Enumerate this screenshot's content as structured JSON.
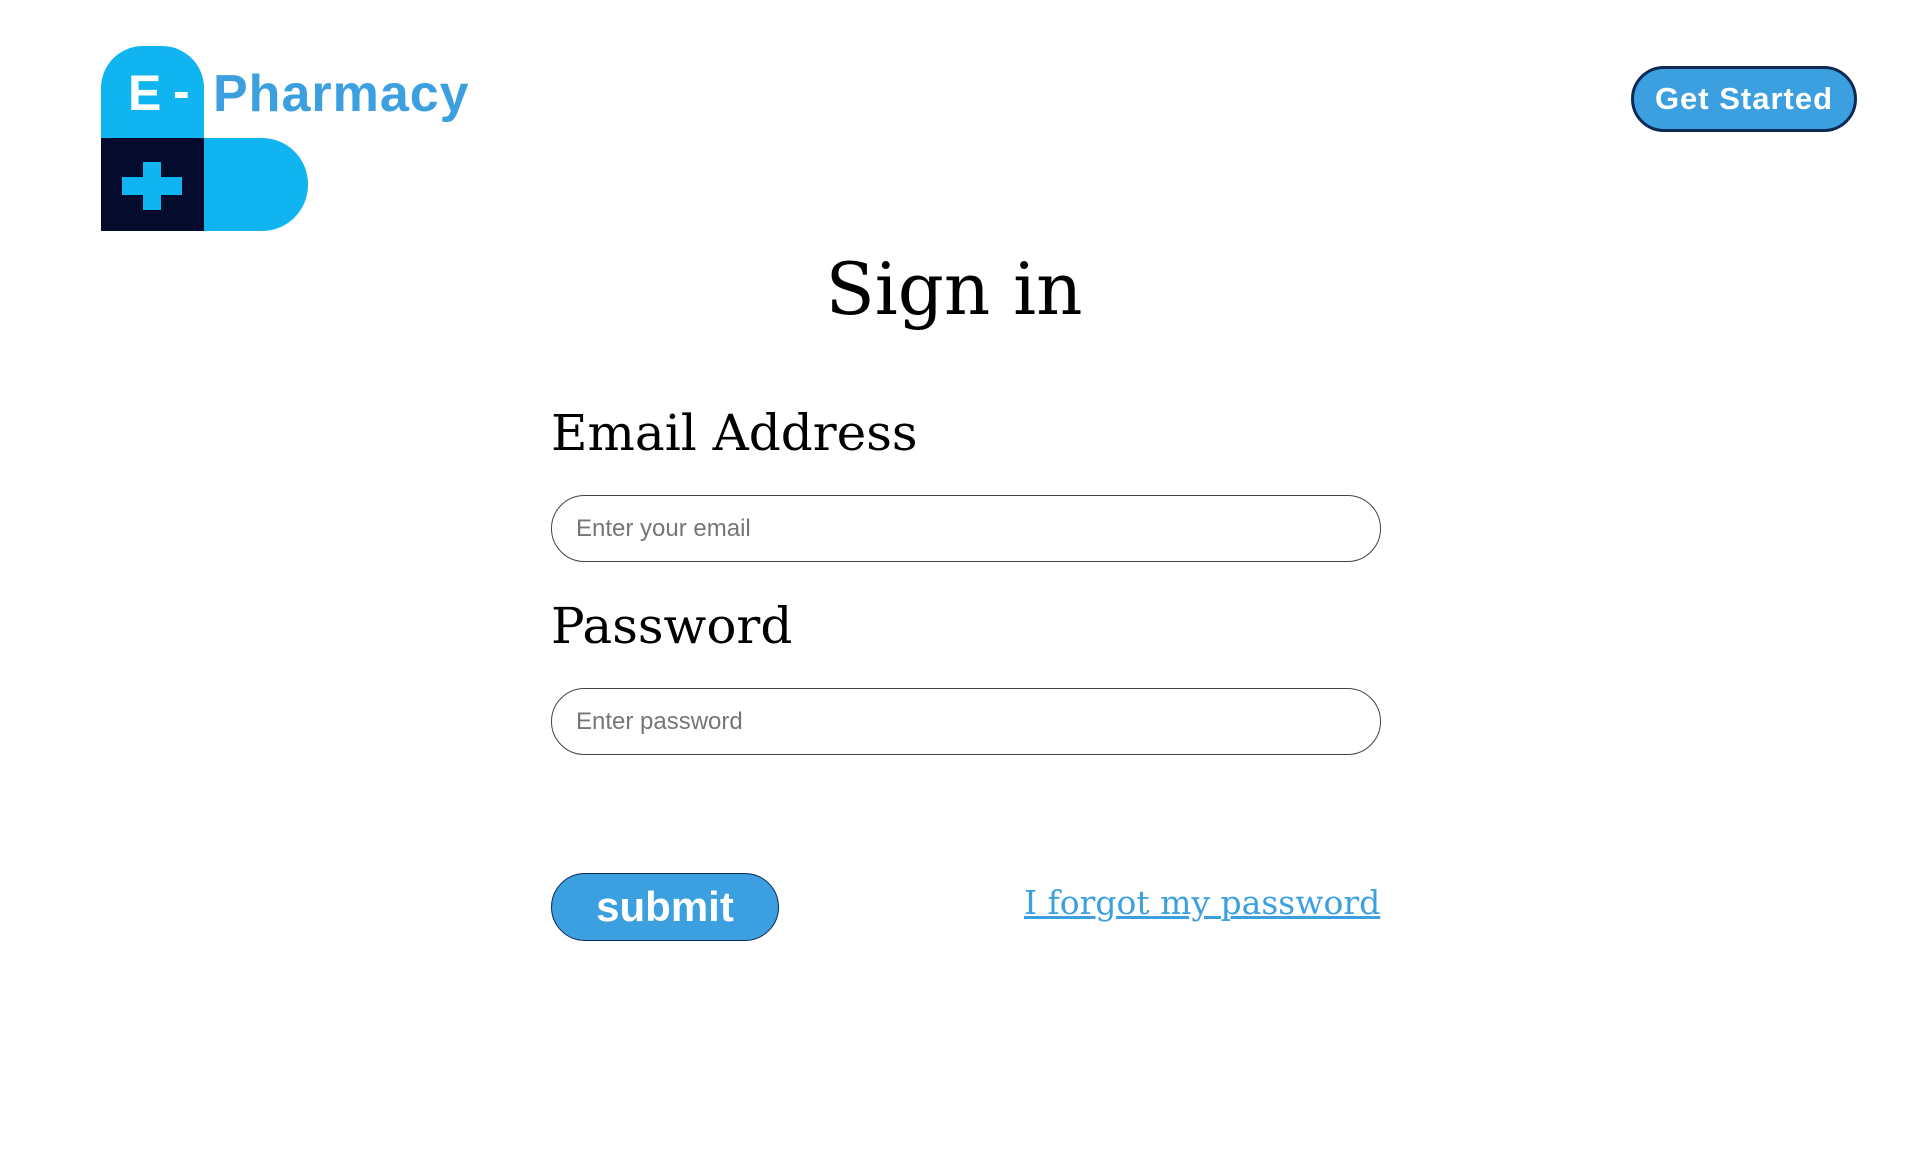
{
  "brand": {
    "logo_letter": "E",
    "logo_dash": "-",
    "name": "Pharmacy",
    "colors": {
      "light_blue": "#10b4f0",
      "dark_navy": "#050b2c",
      "text_blue": "#3b9fe0"
    }
  },
  "header": {
    "get_started_label": "Get Started"
  },
  "form": {
    "title": "Sign in",
    "email_label": "Email Address",
    "email_placeholder": "Enter your email",
    "email_value": "",
    "password_label": "Password",
    "password_placeholder": "Enter password",
    "password_value": "",
    "submit_label": "submit",
    "forgot_label": "I forgot my password"
  },
  "colors": {
    "accent": "#3c9fe0",
    "button_border": "#0b2a55",
    "background": "#ffffff"
  }
}
